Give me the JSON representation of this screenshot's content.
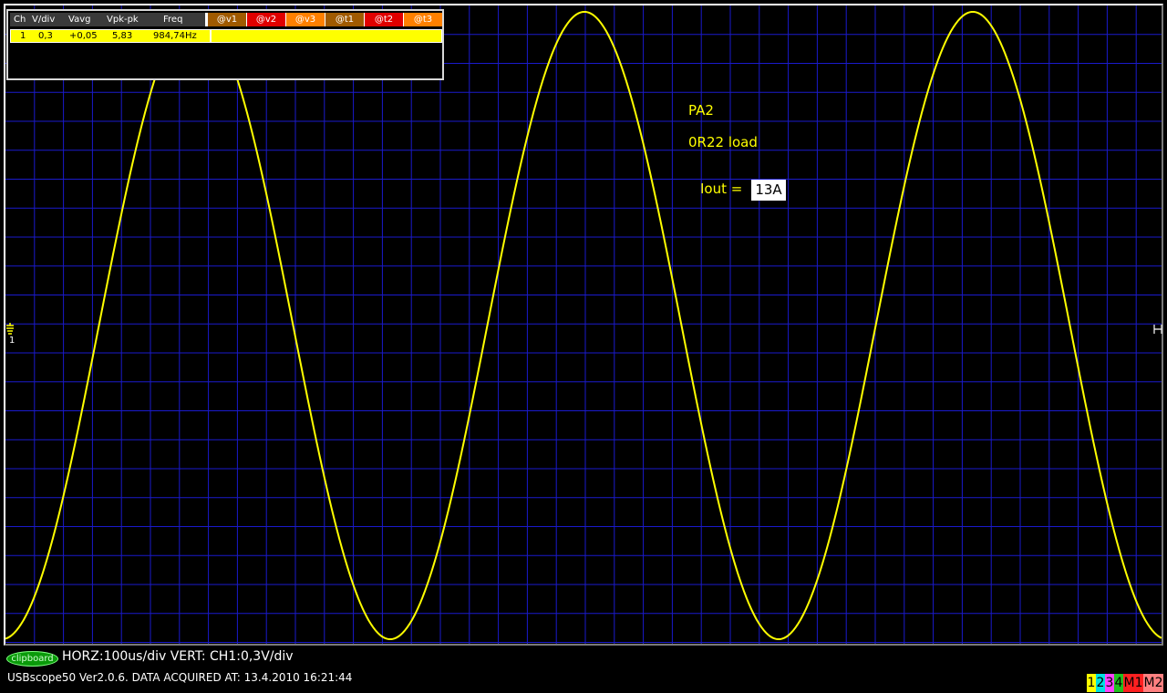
{
  "measurement_table": {
    "headers": [
      "Ch",
      "V/div",
      "Vavg",
      "Vpk-pk",
      "Freq"
    ],
    "cursor_buttons": [
      {
        "label": "@v1",
        "color": "#a05a00"
      },
      {
        "label": "@v2",
        "color": "#e00000"
      },
      {
        "label": "@v3",
        "color": "#ff8000"
      },
      {
        "label": "@t1",
        "color": "#a05a00"
      },
      {
        "label": "@t2",
        "color": "#e00000"
      },
      {
        "label": "@t3",
        "color": "#ff8000"
      }
    ],
    "row": {
      "ch": "1",
      "vdiv": "0,3",
      "vavg": "+0,05",
      "vpkpk": "5,83",
      "freq": "984,74Hz"
    },
    "row_color": "#ffff00"
  },
  "annotations": {
    "line1": "PA2",
    "line2": "0R22 load",
    "iout_label": "Iout =",
    "iout_value": "13A"
  },
  "status": {
    "clipboard_label": "clipboard",
    "settings": "HORZ:100us/div VERT: CH1:0,3V/div",
    "info": "USBscope50 Ver2.0.6.  DATA ACQUIRED AT: 13.4.2010 16:21:44"
  },
  "channel_tabs": [
    {
      "label": "1",
      "bg": "#ffff00",
      "fg": "#000000"
    },
    {
      "label": "2",
      "bg": "#00e0e0",
      "fg": "#000000"
    },
    {
      "label": "3",
      "bg": "#ff40ff",
      "fg": "#000000"
    },
    {
      "label": "4",
      "bg": "#20c020",
      "fg": "#000000"
    },
    {
      "label": "M1",
      "bg": "#ff2020",
      "fg": "#000000"
    },
    {
      "label": "M2",
      "bg": "#ff8080",
      "fg": "#000000"
    }
  ],
  "markers": {
    "ground_channel": "1"
  },
  "colors": {
    "grid": "#1a1acc",
    "trace": "#ffff00",
    "background": "#000000"
  },
  "chart_data": {
    "type": "line",
    "series": [
      {
        "name": "1",
        "color": "#ffff00"
      }
    ],
    "xlabel": "",
    "ylabel": "",
    "grid": true,
    "horizontal_scale": "100us/div",
    "vertical_scale": "0,3V/div",
    "frequency": "984,74Hz",
    "vpk_pk": "5,83",
    "vavg": "+0,05"
  }
}
